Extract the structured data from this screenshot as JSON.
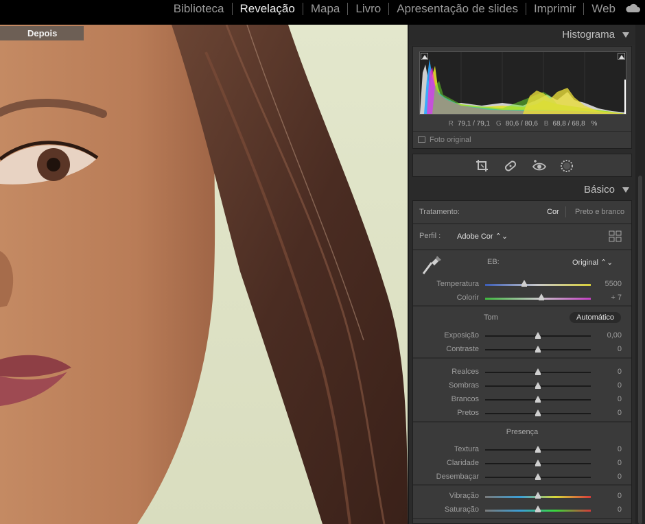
{
  "modules": [
    "Biblioteca",
    "Revelação",
    "Mapa",
    "Livro",
    "Apresentação de slides",
    "Imprimir",
    "Web"
  ],
  "active_module": "Revelação",
  "view": {
    "badge": "Depois"
  },
  "histogram": {
    "title": "Histograma",
    "r_label": "R",
    "r_value": "79,1 /  79,1",
    "g_label": "G",
    "g_value": "80,6 / 80,6",
    "b_label": "B",
    "b_value": "68,8 / 68,8",
    "unit": "%",
    "original_photo_label": "Foto original"
  },
  "basic": {
    "title": "Básico",
    "treatment_label": "Tratamento:",
    "treatment_color": "Cor",
    "treatment_bw": "Preto e branco",
    "profile_label": "Perfil :",
    "profile_value": "Adobe Cor ⌃⌄",
    "wb_label": "EB:",
    "wb_value": "Original ⌃⌄",
    "tone_label": "Tom",
    "auto_label": "Automático",
    "presence_label": "Presença",
    "sliders": {
      "temperatura": {
        "label": "Temperatura",
        "value": "5500",
        "level": 0.37
      },
      "colorir": {
        "label": "Colorir",
        "value": "+ 7",
        "level": 0.53
      },
      "exposicao": {
        "label": "Exposição",
        "value": "0,00",
        "level": 0.5
      },
      "contraste": {
        "label": "Contraste",
        "value": "0",
        "level": 0.5
      },
      "realces": {
        "label": "Realces",
        "value": "0",
        "level": 0.5
      },
      "sombras": {
        "label": "Sombras",
        "value": "0",
        "level": 0.5
      },
      "brancos": {
        "label": "Brancos",
        "value": "0",
        "level": 0.5
      },
      "pretos": {
        "label": "Pretos",
        "value": "0",
        "level": 0.5
      },
      "textura": {
        "label": "Textura",
        "value": "0",
        "level": 0.5
      },
      "claridade": {
        "label": "Claridade",
        "value": "0",
        "level": 0.5
      },
      "desembacar": {
        "label": "Desembaçar",
        "value": "0",
        "level": 0.5
      },
      "vibracao": {
        "label": "Vibração",
        "value": "0",
        "level": 0.5
      },
      "saturacao": {
        "label": "Saturação",
        "value": "0",
        "level": 0.5
      }
    }
  }
}
